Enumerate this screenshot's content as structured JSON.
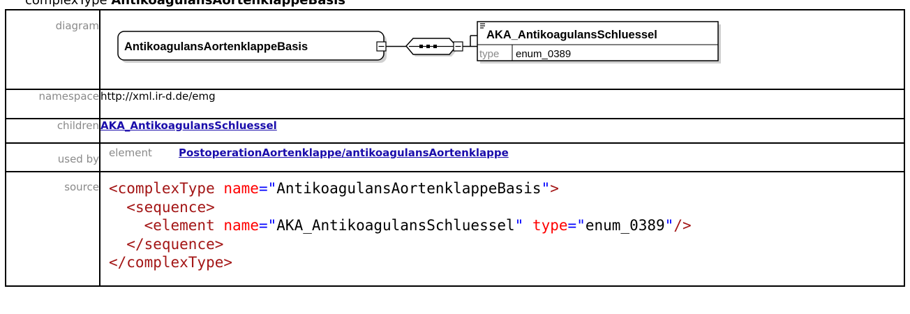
{
  "heading": {
    "prefix": "complexType",
    "name": "AntikoagulansAortenklappeBasis"
  },
  "rows": {
    "diagram_label": "diagram",
    "namespace_label": "namespace",
    "children_label": "children",
    "usedby_label": "used by",
    "source_label": "source"
  },
  "diagram": {
    "complex_type": "AntikoagulansAortenklappeBasis",
    "element_name": "AKA_AntikoagulansSchluessel",
    "type_keyword": "type",
    "type_value": "enum_0389"
  },
  "namespace": "http://xml.ir-d.de/emg",
  "children": [
    "AKA_AntikoagulansSchluessel"
  ],
  "used_by": {
    "kind": "element",
    "link": "PostoperationAortenklappe/antikoagulansAortenklappe"
  },
  "source": {
    "line1": {
      "open": "<complexType",
      "attr": "name",
      "eq": "=",
      "q1": "\"",
      "val": "AntikoagulansAortenklappeBasis",
      "q2": "\"",
      "close": ">"
    },
    "line2": "<sequence>",
    "line3": {
      "open": "<element",
      "attr1": "name",
      "eq1": "=",
      "q1a": "\"",
      "val1": "AKA_AntikoagulansSchluessel",
      "q1b": "\"",
      "attr2": "type",
      "eq2": "=",
      "q2a": "\"",
      "val2": "enum_0389",
      "q2b": "\"",
      "close": "/>"
    },
    "line4": "</sequence>",
    "line5": "</complexType>"
  }
}
